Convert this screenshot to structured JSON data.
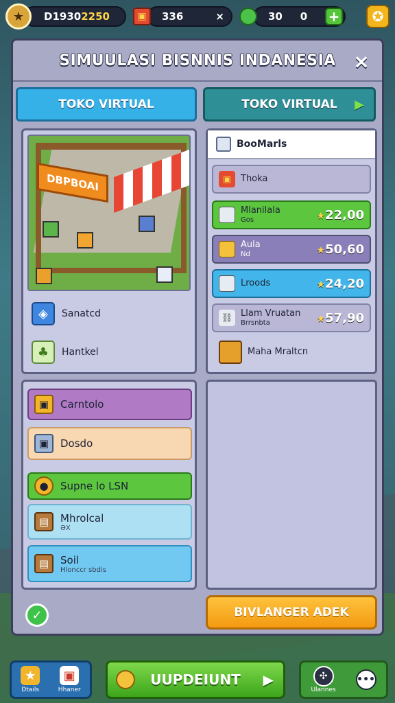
{
  "topbar": {
    "money_a": "D1930",
    "money_b": "2250",
    "gifts": "336",
    "gifts_close": "×",
    "gems": "30",
    "gems_count": "0",
    "plus": "+"
  },
  "panel": {
    "title": "SIMUULASI BISNNIS INDANESIA",
    "close": "×",
    "tab1": "TOKO VIRTUAL",
    "tab2": "TOKO VIRTUAL"
  },
  "shop": {
    "sign": "DBPBOAI"
  },
  "left_items": [
    {
      "label": "Sanatcd"
    },
    {
      "label": "Hantkel"
    }
  ],
  "left_bars": [
    {
      "label": "Carntolo"
    },
    {
      "label": "Dosdo"
    },
    {
      "label": "Supne lo LSN"
    },
    {
      "label": "Mhrolcal",
      "sub": "ƏX"
    },
    {
      "label": "Soil",
      "sub": "Hlonccr sbdis"
    }
  ],
  "right": {
    "header": "BooMarls",
    "items": [
      {
        "name": "Thoka",
        "sub": "",
        "price": ""
      },
      {
        "name": "Mlanilala",
        "sub": "Gos",
        "price": "22,00"
      },
      {
        "name": "Aula",
        "sub": "Nd",
        "price": "50,60"
      },
      {
        "name": "Lroods",
        "sub": "",
        "price": "24,20"
      },
      {
        "name": "Llam Vruatan",
        "sub": "Brrsnbta",
        "price": "57,90"
      },
      {
        "name": "Maha Mraltcn",
        "sub": "",
        "price": ""
      }
    ]
  },
  "cta": "BIVLANGER ADEK",
  "bottom": {
    "nav1": "Dtails",
    "nav2": "Hhaner",
    "update": "UUPDEIUNT",
    "right_label": "Ulannes",
    "more": "•••"
  },
  "colors": {
    "tab_blue": "#35b1e8",
    "tab_teal": "#2f8f96",
    "green": "#5bc63a",
    "orange": "#f39a12",
    "purple": "#a07ac4",
    "peach": "#f5d4ad",
    "blue_item": "#42b6ea"
  },
  "icons": [
    "star-icon",
    "gift-icon",
    "gem-icon",
    "plus-icon",
    "close-icon",
    "arrow-right-icon",
    "box-icon",
    "plant-icon",
    "crate-icon",
    "check-icon",
    "coin-icon"
  ]
}
